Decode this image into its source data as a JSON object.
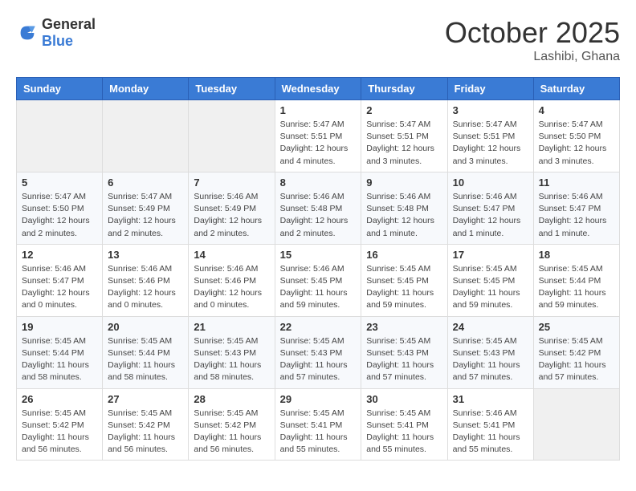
{
  "logo": {
    "general": "General",
    "blue": "Blue"
  },
  "header": {
    "month": "October 2025",
    "location": "Lashibi, Ghana"
  },
  "days_of_week": [
    "Sunday",
    "Monday",
    "Tuesday",
    "Wednesday",
    "Thursday",
    "Friday",
    "Saturday"
  ],
  "weeks": [
    [
      {
        "day": "",
        "sunrise": "",
        "sunset": "",
        "daylight": ""
      },
      {
        "day": "",
        "sunrise": "",
        "sunset": "",
        "daylight": ""
      },
      {
        "day": "",
        "sunrise": "",
        "sunset": "",
        "daylight": ""
      },
      {
        "day": "1",
        "sunrise": "Sunrise: 5:47 AM",
        "sunset": "Sunset: 5:51 PM",
        "daylight": "Daylight: 12 hours and 4 minutes."
      },
      {
        "day": "2",
        "sunrise": "Sunrise: 5:47 AM",
        "sunset": "Sunset: 5:51 PM",
        "daylight": "Daylight: 12 hours and 3 minutes."
      },
      {
        "day": "3",
        "sunrise": "Sunrise: 5:47 AM",
        "sunset": "Sunset: 5:51 PM",
        "daylight": "Daylight: 12 hours and 3 minutes."
      },
      {
        "day": "4",
        "sunrise": "Sunrise: 5:47 AM",
        "sunset": "Sunset: 5:50 PM",
        "daylight": "Daylight: 12 hours and 3 minutes."
      }
    ],
    [
      {
        "day": "5",
        "sunrise": "Sunrise: 5:47 AM",
        "sunset": "Sunset: 5:50 PM",
        "daylight": "Daylight: 12 hours and 2 minutes."
      },
      {
        "day": "6",
        "sunrise": "Sunrise: 5:47 AM",
        "sunset": "Sunset: 5:49 PM",
        "daylight": "Daylight: 12 hours and 2 minutes."
      },
      {
        "day": "7",
        "sunrise": "Sunrise: 5:46 AM",
        "sunset": "Sunset: 5:49 PM",
        "daylight": "Daylight: 12 hours and 2 minutes."
      },
      {
        "day": "8",
        "sunrise": "Sunrise: 5:46 AM",
        "sunset": "Sunset: 5:48 PM",
        "daylight": "Daylight: 12 hours and 2 minutes."
      },
      {
        "day": "9",
        "sunrise": "Sunrise: 5:46 AM",
        "sunset": "Sunset: 5:48 PM",
        "daylight": "Daylight: 12 hours and 1 minute."
      },
      {
        "day": "10",
        "sunrise": "Sunrise: 5:46 AM",
        "sunset": "Sunset: 5:47 PM",
        "daylight": "Daylight: 12 hours and 1 minute."
      },
      {
        "day": "11",
        "sunrise": "Sunrise: 5:46 AM",
        "sunset": "Sunset: 5:47 PM",
        "daylight": "Daylight: 12 hours and 1 minute."
      }
    ],
    [
      {
        "day": "12",
        "sunrise": "Sunrise: 5:46 AM",
        "sunset": "Sunset: 5:47 PM",
        "daylight": "Daylight: 12 hours and 0 minutes."
      },
      {
        "day": "13",
        "sunrise": "Sunrise: 5:46 AM",
        "sunset": "Sunset: 5:46 PM",
        "daylight": "Daylight: 12 hours and 0 minutes."
      },
      {
        "day": "14",
        "sunrise": "Sunrise: 5:46 AM",
        "sunset": "Sunset: 5:46 PM",
        "daylight": "Daylight: 12 hours and 0 minutes."
      },
      {
        "day": "15",
        "sunrise": "Sunrise: 5:46 AM",
        "sunset": "Sunset: 5:45 PM",
        "daylight": "Daylight: 11 hours and 59 minutes."
      },
      {
        "day": "16",
        "sunrise": "Sunrise: 5:45 AM",
        "sunset": "Sunset: 5:45 PM",
        "daylight": "Daylight: 11 hours and 59 minutes."
      },
      {
        "day": "17",
        "sunrise": "Sunrise: 5:45 AM",
        "sunset": "Sunset: 5:45 PM",
        "daylight": "Daylight: 11 hours and 59 minutes."
      },
      {
        "day": "18",
        "sunrise": "Sunrise: 5:45 AM",
        "sunset": "Sunset: 5:44 PM",
        "daylight": "Daylight: 11 hours and 59 minutes."
      }
    ],
    [
      {
        "day": "19",
        "sunrise": "Sunrise: 5:45 AM",
        "sunset": "Sunset: 5:44 PM",
        "daylight": "Daylight: 11 hours and 58 minutes."
      },
      {
        "day": "20",
        "sunrise": "Sunrise: 5:45 AM",
        "sunset": "Sunset: 5:44 PM",
        "daylight": "Daylight: 11 hours and 58 minutes."
      },
      {
        "day": "21",
        "sunrise": "Sunrise: 5:45 AM",
        "sunset": "Sunset: 5:43 PM",
        "daylight": "Daylight: 11 hours and 58 minutes."
      },
      {
        "day": "22",
        "sunrise": "Sunrise: 5:45 AM",
        "sunset": "Sunset: 5:43 PM",
        "daylight": "Daylight: 11 hours and 57 minutes."
      },
      {
        "day": "23",
        "sunrise": "Sunrise: 5:45 AM",
        "sunset": "Sunset: 5:43 PM",
        "daylight": "Daylight: 11 hours and 57 minutes."
      },
      {
        "day": "24",
        "sunrise": "Sunrise: 5:45 AM",
        "sunset": "Sunset: 5:43 PM",
        "daylight": "Daylight: 11 hours and 57 minutes."
      },
      {
        "day": "25",
        "sunrise": "Sunrise: 5:45 AM",
        "sunset": "Sunset: 5:42 PM",
        "daylight": "Daylight: 11 hours and 57 minutes."
      }
    ],
    [
      {
        "day": "26",
        "sunrise": "Sunrise: 5:45 AM",
        "sunset": "Sunset: 5:42 PM",
        "daylight": "Daylight: 11 hours and 56 minutes."
      },
      {
        "day": "27",
        "sunrise": "Sunrise: 5:45 AM",
        "sunset": "Sunset: 5:42 PM",
        "daylight": "Daylight: 11 hours and 56 minutes."
      },
      {
        "day": "28",
        "sunrise": "Sunrise: 5:45 AM",
        "sunset": "Sunset: 5:42 PM",
        "daylight": "Daylight: 11 hours and 56 minutes."
      },
      {
        "day": "29",
        "sunrise": "Sunrise: 5:45 AM",
        "sunset": "Sunset: 5:41 PM",
        "daylight": "Daylight: 11 hours and 55 minutes."
      },
      {
        "day": "30",
        "sunrise": "Sunrise: 5:45 AM",
        "sunset": "Sunset: 5:41 PM",
        "daylight": "Daylight: 11 hours and 55 minutes."
      },
      {
        "day": "31",
        "sunrise": "Sunrise: 5:46 AM",
        "sunset": "Sunset: 5:41 PM",
        "daylight": "Daylight: 11 hours and 55 minutes."
      },
      {
        "day": "",
        "sunrise": "",
        "sunset": "",
        "daylight": ""
      }
    ]
  ]
}
